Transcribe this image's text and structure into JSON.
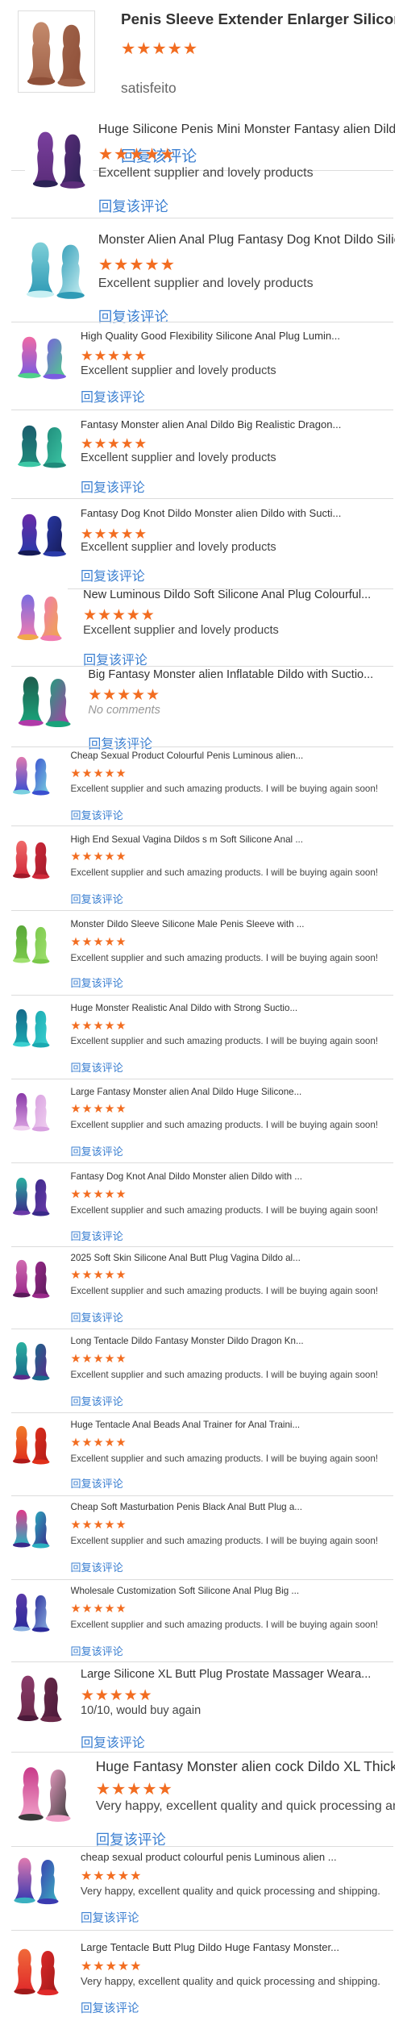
{
  "reviews": [
    {
      "title": "Penis Sleeve Extender Enlarger Silicone Cock Sleeves...",
      "stars": "★★★★★",
      "user": "satisfeito",
      "comment": "",
      "reply": "回复该评论",
      "colors": [
        "#a0634a",
        "#c48a6c",
        "#8e4f38"
      ]
    },
    {
      "title": "Huge Silicone Penis Mini Monster Fantasy alien Dildo ...",
      "stars": "★★★★★",
      "comment": "Excellent supplier and lovely products",
      "reply": "回复该评论",
      "colors": [
        "#5b2d7a",
        "#7a3f9e",
        "#2b2255"
      ]
    },
    {
      "title": "Monster Alien Anal Plug Fantasy Dog Knot Dildo Silic...",
      "stars": "★★★★★",
      "comment": "Excellent supplier and lovely products",
      "reply": "回复该评论",
      "colors": [
        "#2f9bb6",
        "#7fcfd8",
        "#c8f0f3"
      ]
    },
    {
      "title": "High Quality Good Flexibility Silicone Anal Plug Lumin...",
      "stars": "★★★★★",
      "comment": "Excellent supplier and lovely products",
      "reply": "回复该评论",
      "colors": [
        "#7b5ce0",
        "#f06aa5",
        "#4fd08a"
      ]
    },
    {
      "title": "Fantasy Monster alien Anal Dildo Big Realistic Dragon...",
      "stars": "★★★★★",
      "comment": "Excellent supplier and lovely products",
      "reply": "回复该评论",
      "colors": [
        "#1f8a7a",
        "#1b5d6d",
        "#3cc7a5"
      ]
    },
    {
      "title": "Fantasy Dog Knot Dildo Monster alien Dildo with Sucti...",
      "stars": "★★★★★",
      "comment": "Excellent supplier and lovely products",
      "reply": "回复该评论",
      "colors": [
        "#2a3aa8",
        "#6a2aa8",
        "#151a55"
      ]
    },
    {
      "title": "New Luminous Dildo Soft Silicone Anal Plug Colourful...",
      "stars": "★★★★★",
      "comment": "Excellent supplier and lovely products",
      "reply": "回复该评论",
      "colors": [
        "#f07bb0",
        "#7a6ce0",
        "#f0a84a"
      ]
    },
    {
      "title": "Big Fantasy Monster alien Inflatable Dildo with Suctio...",
      "stars": "★★★★★",
      "comment": "No comments",
      "reply": "回复该评论",
      "colors": [
        "#1aa37a",
        "#1e5d4d",
        "#b03aa8"
      ]
    },
    {
      "title": "Cheap Sexual Product Colourful Penis Luminous alien...",
      "stars": "★★★★★",
      "comment": "Excellent supplier and such amazing products. I will be buying again soon!",
      "reply": "回复该评论",
      "colors": [
        "#3a4fd0",
        "#e07ab0",
        "#7ad0e0"
      ]
    },
    {
      "title": "High End Sexual Vagina Dildos s m Soft Silicone Anal ...",
      "stars": "★★★★★",
      "comment": "Excellent supplier and such amazing products. I will be buying again soon!",
      "reply": "回复该评论",
      "colors": [
        "#d02a3a",
        "#f06a6a",
        "#a01a2a"
      ]
    },
    {
      "title": "Monster Dildo Sleeve Silicone Male Penis Sleeve with ...",
      "stars": "★★★★★",
      "comment": "Excellent supplier and such amazing products. I will be buying again soon!",
      "reply": "回复该评论",
      "colors": [
        "#7ac84a",
        "#5aa83a",
        "#a0e070"
      ]
    },
    {
      "title": "Huge Monster Realistic Anal Dildo with Strong Suctio...",
      "stars": "★★★★★",
      "comment": "Excellent supplier and such amazing products. I will be buying again soon!",
      "reply": "回复该评论",
      "colors": [
        "#1aa8b0",
        "#156a8a",
        "#3ad0d0"
      ]
    },
    {
      "title": "Large Fantasy Monster alien Anal Dildo Huge Silicone...",
      "stars": "★★★★★",
      "comment": "Excellent supplier and such amazing products. I will be buying again soon!",
      "reply": "回复该评论",
      "colors": [
        "#d8a0e0",
        "#8a3aa8",
        "#f0d0f0"
      ]
    },
    {
      "title": "Fantasy Dog Knot Anal Dildo Monster alien Dildo with ...",
      "stars": "★★★★★",
      "comment": "Excellent supplier and such amazing products. I will be buying again soon!",
      "reply": "回复该评论",
      "colors": [
        "#3a2a8a",
        "#2ab0a0",
        "#6a3aa8"
      ]
    },
    {
      "title": "2025 Soft Skin Silicone Anal Butt Plug Vagina Dildo al...",
      "stars": "★★★★★",
      "comment": "Excellent supplier and such amazing products. I will be buying again soon!",
      "reply": "回复该评论",
      "colors": [
        "#9a2a8a",
        "#d06ab0",
        "#5a1a5a"
      ]
    },
    {
      "title": "Long Tentacle Dildo Fantasy Monster Dildo Dragon Kn...",
      "stars": "★★★★★",
      "comment": "Excellent supplier and such amazing products. I will be buying again soon!",
      "reply": "回复该评论",
      "colors": [
        "#1a6a8a",
        "#2ab0a0",
        "#5a2a8a"
      ]
    },
    {
      "title": "Huge Tentacle Anal Beads Anal Trainer for Anal Traini...",
      "stars": "★★★★★",
      "comment": "Excellent supplier and such amazing products. I will be buying again soon!",
      "reply": "回复该评论",
      "colors": [
        "#e0301a",
        "#f07a2a",
        "#b01a1a"
      ]
    },
    {
      "title": "Cheap Soft Masturbation Penis Black Anal Butt Plug a...",
      "stars": "★★★★★",
      "comment": "Excellent supplier and such amazing products. I will be buying again soon!",
      "reply": "回复该评论",
      "colors": [
        "#2ab0c0",
        "#e03a8a",
        "#3a2a8a"
      ]
    },
    {
      "title": "Wholesale Customization Soft Silicone Anal Plug Big ...",
      "stars": "★★★★★",
      "comment": "Excellent supplier and such amazing products. I will be buying again soon!",
      "reply": "回复该评论",
      "colors": [
        "#2a2a9a",
        "#5a3aa8",
        "#8ab0e0"
      ]
    },
    {
      "title": "Large Silicone XL Butt Plug Prostate Massager Weara...",
      "stars": "★★★★★",
      "comment": "10/10, would buy again",
      "reply": "回复该评论",
      "colors": [
        "#6a2a4a",
        "#8a3a6a",
        "#4a1a3a"
      ]
    },
    {
      "title": "Huge Fantasy Monster alien cock Dildo XL Thick Dild...",
      "stars": "★★★★★",
      "comment": "Very happy, excellent quality and quick processing and shipping.",
      "reply": "回复该评论",
      "colors": [
        "#f0a0c8",
        "#c83a8a",
        "#3a3a3a"
      ]
    },
    {
      "title": "cheap sexual product colourful penis Luminous alien ...",
      "stars": "★★★★★",
      "comment": "Very happy, excellent quality and quick processing and shipping.",
      "reply": "回复该评论",
      "colors": [
        "#3a3ab0",
        "#e07ab0",
        "#3ab0c0"
      ]
    },
    {
      "title": "Large Tentacle Butt Plug Dildo Huge Fantasy Monster...",
      "stars": "★★★★★",
      "comment": "Very happy, excellent quality and quick processing and shipping.",
      "reply": "回复该评论",
      "colors": [
        "#e02a2a",
        "#f06a3a",
        "#a01a1a"
      ]
    }
  ]
}
